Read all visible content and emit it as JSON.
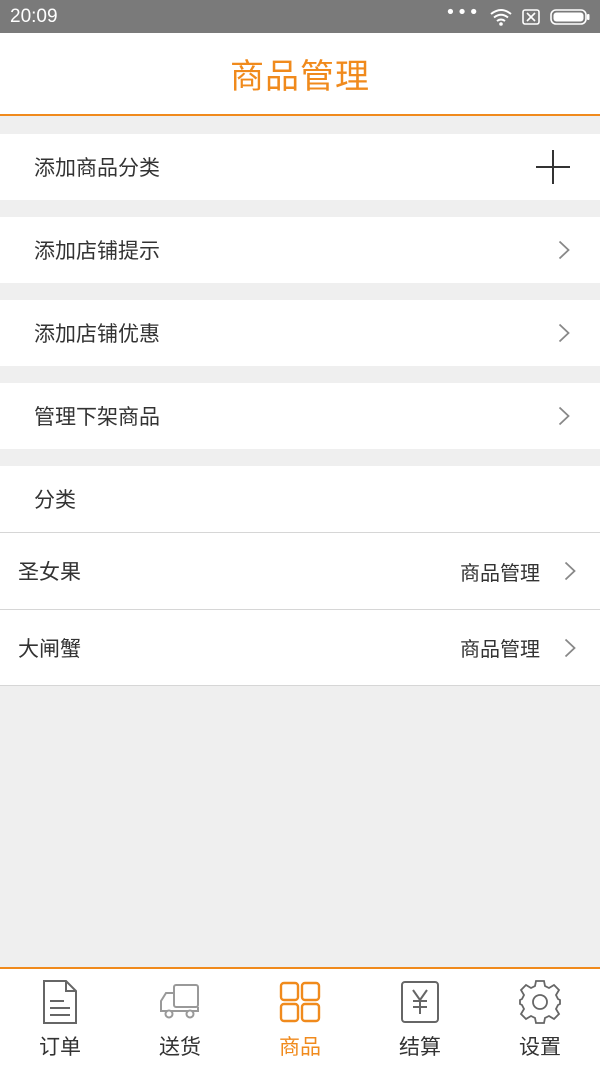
{
  "status_bar": {
    "time": "20:09"
  },
  "header": {
    "title": "商品管理"
  },
  "menu": [
    {
      "label": "添加商品分类",
      "icon": "plus-icon"
    },
    {
      "label": "添加店铺提示",
      "icon": "chevron-right-icon"
    },
    {
      "label": "添加店铺优惠",
      "icon": "chevron-right-icon"
    },
    {
      "label": "管理下架商品",
      "icon": "chevron-right-icon"
    }
  ],
  "category_section": {
    "title": "分类"
  },
  "categories": [
    {
      "name": "圣女果",
      "action": "商品管理"
    },
    {
      "name": "大闸蟹",
      "action": "商品管理"
    }
  ],
  "tabbar": {
    "items": [
      {
        "label": "订单",
        "icon": "order-doc-icon",
        "active": false
      },
      {
        "label": "送货",
        "icon": "delivery-truck-icon",
        "active": false
      },
      {
        "label": "商品",
        "icon": "goods-grid-icon",
        "active": true
      },
      {
        "label": "结算",
        "icon": "yuan-settle-icon",
        "active": false
      },
      {
        "label": "设置",
        "icon": "gear-icon",
        "active": false
      }
    ]
  },
  "colors": {
    "accent": "#f08a1c",
    "background": "#efefef",
    "status_bar": "#7a7a7a"
  }
}
